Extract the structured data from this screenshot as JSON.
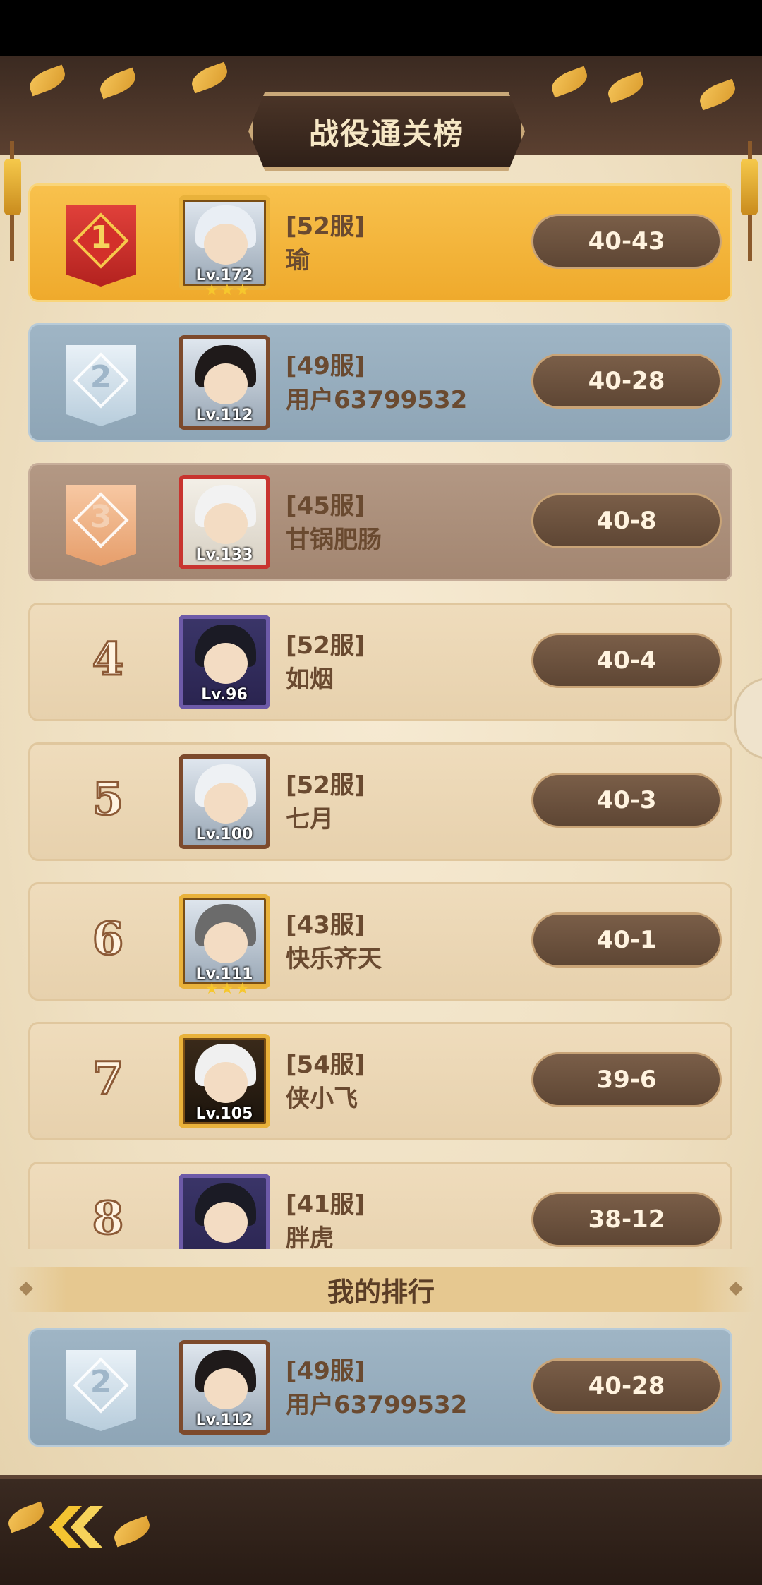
{
  "page": {
    "title": "战役通关榜",
    "my_rank_label": "我的排行"
  },
  "colors": {
    "gold_row": "#f5b73b",
    "silver_row": "#97aebf",
    "bronze_row": "#ab8f7a",
    "plain_row": "#ecd8b6",
    "score_pill": "#6a503d",
    "text_brown": "#6a4a30"
  },
  "ranking": [
    {
      "rank": "1",
      "badge": "gold-ribbon",
      "level": "Lv.172",
      "server": "[52服]",
      "name": "瑜",
      "score": "40-43",
      "frame": "gold",
      "stars": "★★★"
    },
    {
      "rank": "2",
      "badge": "silver-ribbon",
      "level": "Lv.112",
      "server": "[49服]",
      "name": "用户63799532",
      "score": "40-28",
      "frame": "brown",
      "stars": ""
    },
    {
      "rank": "3",
      "badge": "bronze-ribbon",
      "level": "Lv.133",
      "server": "[45服]",
      "name": "甘锅肥肠",
      "score": "40-8",
      "frame": "red",
      "stars": ""
    },
    {
      "rank": "4",
      "badge": "",
      "level": "Lv.96",
      "server": "[52服]",
      "name": "如烟",
      "score": "40-4",
      "frame": "purple",
      "stars": ""
    },
    {
      "rank": "5",
      "badge": "",
      "level": "Lv.100",
      "server": "[52服]",
      "name": "七月",
      "score": "40-3",
      "frame": "brown",
      "stars": ""
    },
    {
      "rank": "6",
      "badge": "",
      "level": "Lv.111",
      "server": "[43服]",
      "name": "快乐齐天",
      "score": "40-1",
      "frame": "gold",
      "stars": "★★★"
    },
    {
      "rank": "7",
      "badge": "",
      "level": "Lv.105",
      "server": "[54服]",
      "name": "侠小飞",
      "score": "39-6",
      "frame": "gold",
      "stars": ""
    },
    {
      "rank": "8",
      "badge": "",
      "level": "",
      "server": "[41服]",
      "name": "胖虎",
      "score": "38-12",
      "frame": "purple",
      "stars": ""
    }
  ],
  "my_rank": {
    "rank": "2",
    "badge": "silver-ribbon",
    "level": "Lv.112",
    "server": "[49服]",
    "name": "用户63799532",
    "score": "40-28"
  },
  "icons": {
    "back": "back-chevron-icon"
  }
}
